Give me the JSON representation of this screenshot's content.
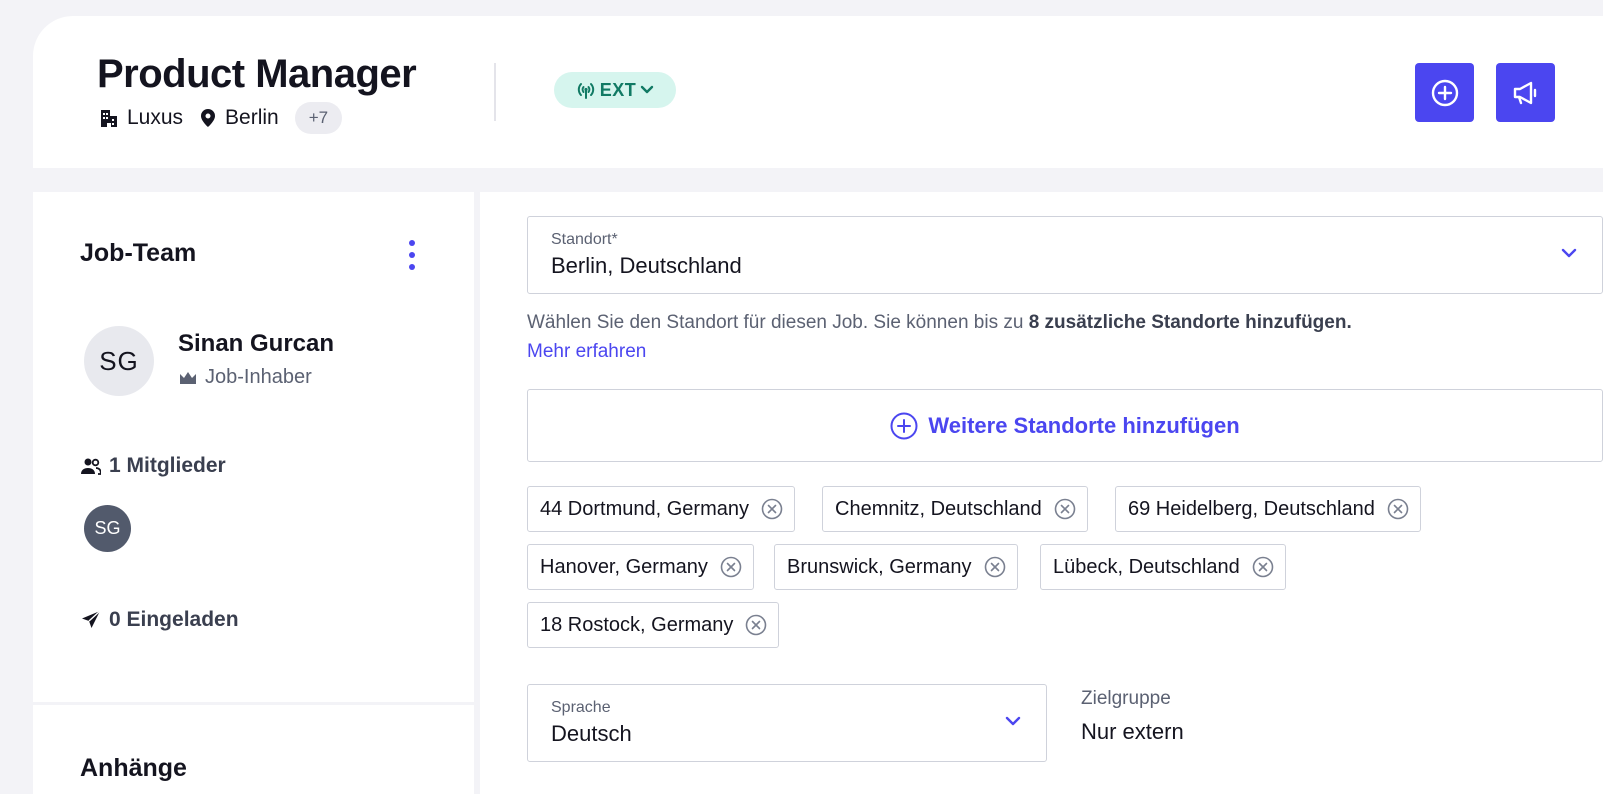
{
  "header": {
    "title": "Product Manager",
    "company": "Luxus",
    "location": "Berlin",
    "more_locations": "+7",
    "visibility_label": "EXT",
    "actions": {
      "add_icon": "plus-circle-icon",
      "announce_icon": "megaphone-icon"
    }
  },
  "sidebar": {
    "title": "Job-Team",
    "owner": {
      "initials": "SG",
      "name": "Sinan Gurcan",
      "role": "Job-Inhaber"
    },
    "members_label": "1 Mitglieder",
    "members": [
      {
        "initials": "SG"
      }
    ],
    "invited_label": "0 Eingeladen",
    "attachments_title": "Anhänge"
  },
  "main": {
    "location_field": {
      "label": "Standort*",
      "value": "Berlin, Deutschland"
    },
    "help_text": "Wählen Sie den Standort für diesen Job. Sie können bis zu ",
    "help_bold": "8 zusätzliche Standorte hinzufügen.",
    "help_link": "Mehr erfahren",
    "add_locations_label": "Weitere Standorte hinzufügen",
    "chips": [
      "44 Dortmund, Germany",
      "Chemnitz, Deutschland",
      "69 Heidelberg, Deutschland",
      "Hanover, Germany",
      "Brunswick, Germany",
      "Lübeck, Deutschland",
      "18 Rostock, Germany"
    ],
    "language_field": {
      "label": "Sprache",
      "value": "Deutsch"
    },
    "audience": {
      "label": "Zielgruppe",
      "value": "Nur extern"
    }
  },
  "colors": {
    "accent": "#4b46f0",
    "ext_bg": "#d6f5ee",
    "ext_text": "#117a64",
    "border": "#cfd2db"
  }
}
